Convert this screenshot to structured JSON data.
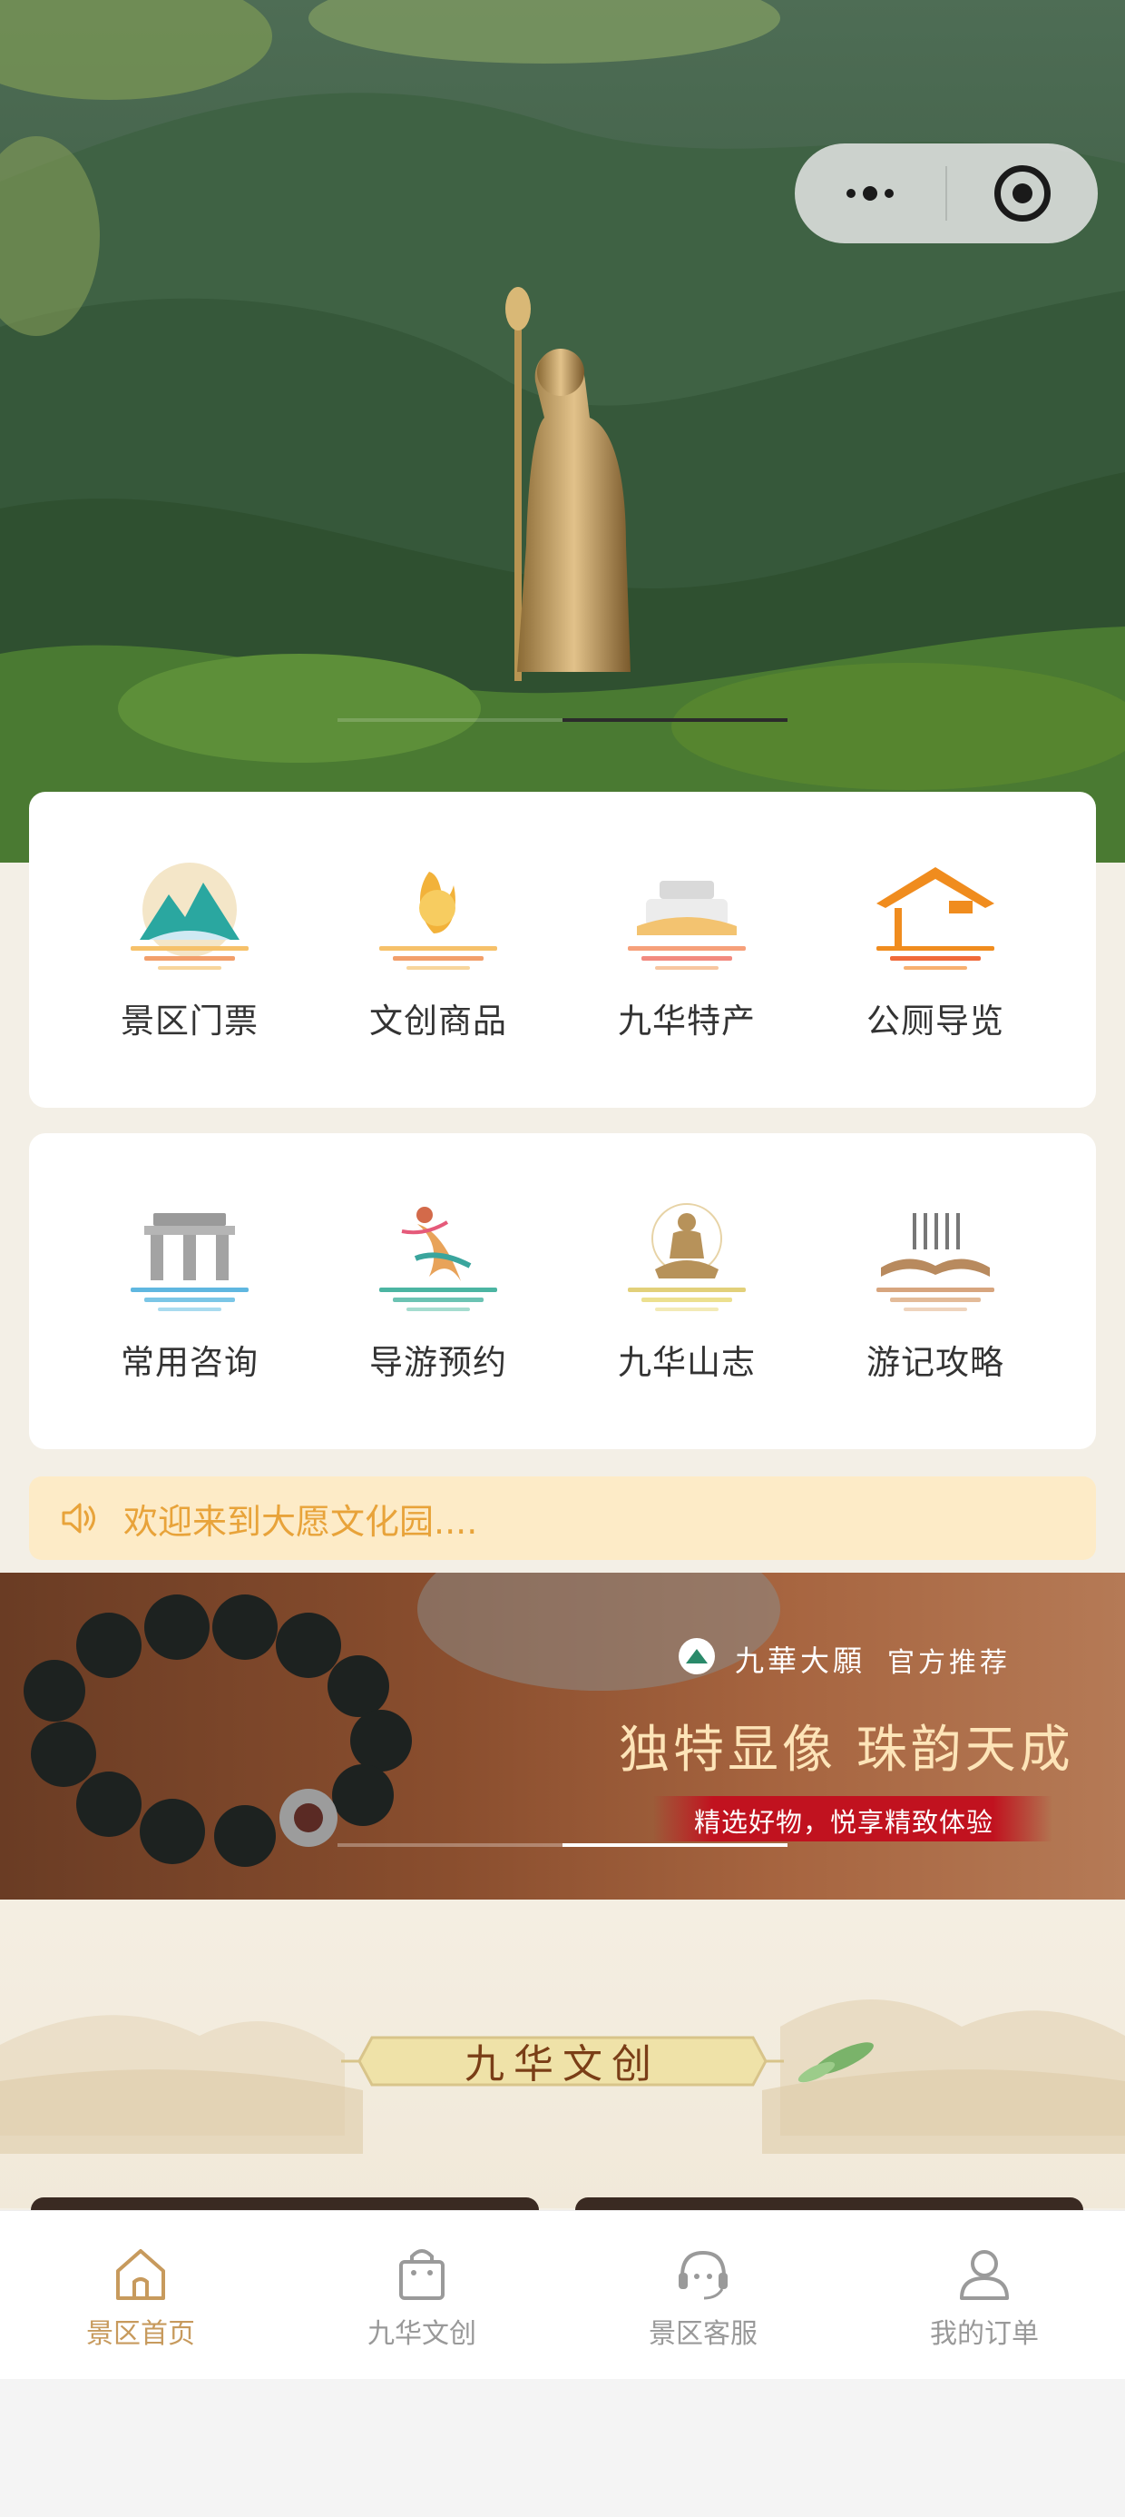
{
  "capsule": {
    "menu_icon": "more-dots-icon",
    "close_icon": "target-circle-icon"
  },
  "grid_row1": [
    {
      "label": "景区门票",
      "icon": "scenic-ticket-icon"
    },
    {
      "label": "文创商品",
      "icon": "cultural-product-icon"
    },
    {
      "label": "九华特产",
      "icon": "local-specialty-icon"
    },
    {
      "label": "公厕导览",
      "icon": "toilet-guide-icon"
    }
  ],
  "grid_row2": [
    {
      "label": "常用咨询",
      "icon": "consult-icon"
    },
    {
      "label": "导游预约",
      "icon": "guide-booking-icon"
    },
    {
      "label": "九华山志",
      "icon": "mountain-chronicle-icon"
    },
    {
      "label": "游记攻略",
      "icon": "travel-notes-icon"
    }
  ],
  "notice": {
    "text": "欢迎来到大愿文化园....",
    "icon": "speaker-icon"
  },
  "banner": {
    "brand": "九華大願",
    "recommend": "官方推荐",
    "slogan": "独特显像  珠韵天成",
    "tagline": "精选好物，悦享精致体验"
  },
  "section": {
    "title": "九华文创"
  },
  "tabbar": [
    {
      "label": "景区首页",
      "icon": "home-icon",
      "active": true
    },
    {
      "label": "九华文创",
      "icon": "shopping-bag-icon",
      "active": false
    },
    {
      "label": "景区客服",
      "icon": "customer-service-icon",
      "active": false
    },
    {
      "label": "我的订单",
      "icon": "user-icon",
      "active": false
    }
  ],
  "colors": {
    "accent": "#c79a5d",
    "notice_bg": "#fdebc7",
    "notice_text": "#e8a33a",
    "title_text": "#7a3e17"
  }
}
